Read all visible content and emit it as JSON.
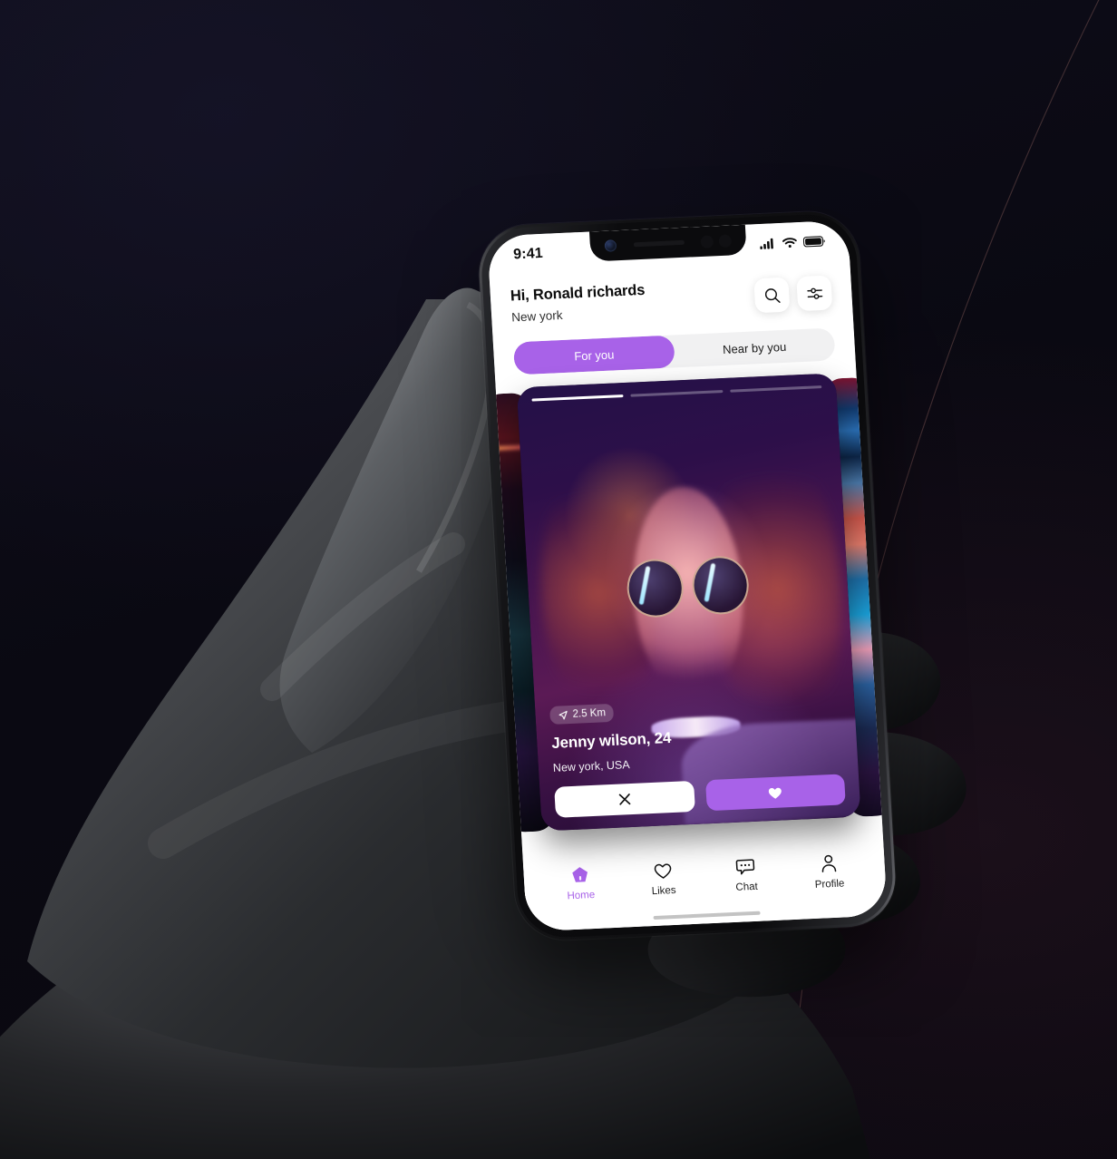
{
  "theme": {
    "accent": "#a862e8",
    "background": "#0b0a14",
    "screen_bg": "#ffffff",
    "tab_track": "#f1f1f2",
    "text_dark": "#0c0c0c"
  },
  "status_bar": {
    "time": "9:41",
    "icons": [
      "cellular-signal-icon",
      "wifi-icon",
      "battery-icon"
    ]
  },
  "header": {
    "greeting": "Hi, Ronald richards",
    "location": "New york",
    "actions": [
      {
        "name": "search-icon",
        "label": "Search"
      },
      {
        "name": "filter-icon",
        "label": "Filter"
      }
    ]
  },
  "tabs": {
    "items": [
      {
        "label": "For you",
        "active": true
      },
      {
        "label": "Near by you",
        "active": false
      }
    ]
  },
  "card": {
    "progress": {
      "total": 3,
      "current": 1
    },
    "distance": "2.5 Km",
    "distance_icon": "location-pin-icon",
    "name": "Jenny wilson, 24",
    "location": "New york, USA",
    "actions": [
      {
        "name": "reject-button",
        "icon": "close-icon",
        "label": "Reject"
      },
      {
        "name": "like-button",
        "icon": "heart-filled-icon",
        "label": "Like"
      }
    ]
  },
  "bottom_nav": {
    "items": [
      {
        "label": "Home",
        "icon": "home-icon",
        "active": true
      },
      {
        "label": "Likes",
        "icon": "heart-outline-icon",
        "active": false
      },
      {
        "label": "Chat",
        "icon": "chat-bubble-icon",
        "active": false
      },
      {
        "label": "Profile",
        "icon": "person-icon",
        "active": false
      }
    ]
  }
}
